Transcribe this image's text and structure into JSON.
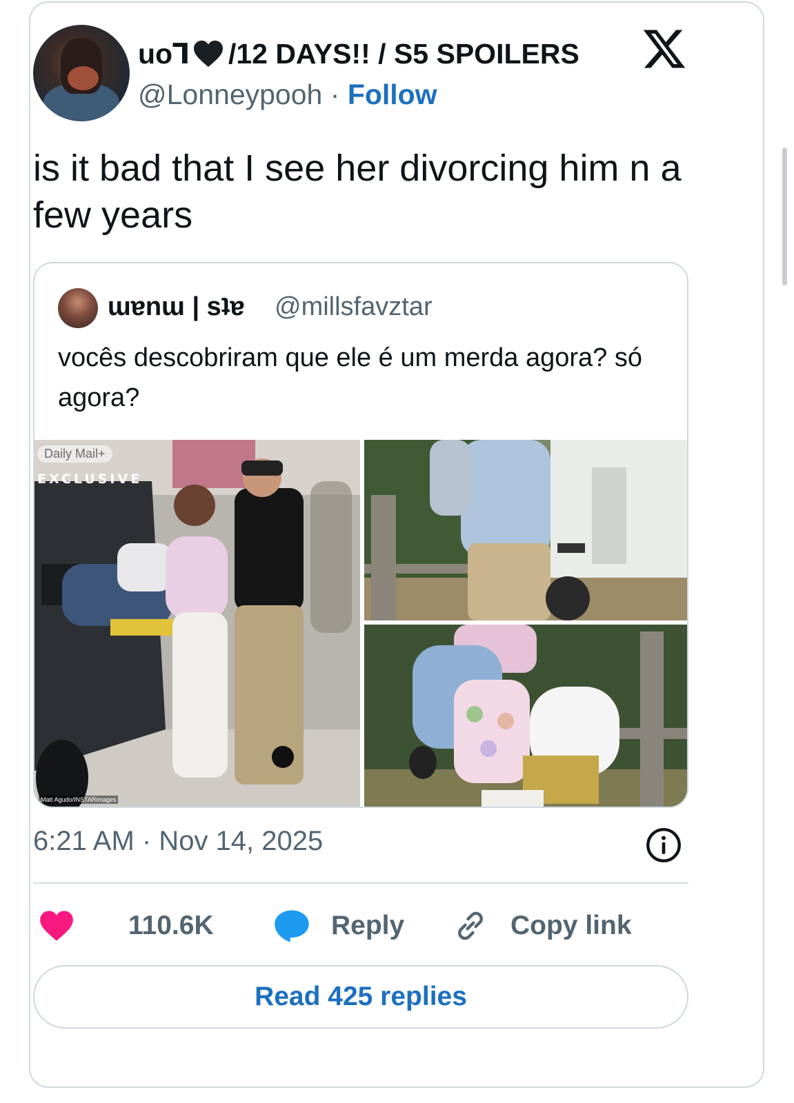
{
  "tweet": {
    "author": {
      "display_name_prefix": "uoꓶ",
      "display_name_suffix": "/12 DAYS!! / S5 SPOILERS",
      "handle": "@Lonneypooh",
      "separator": "·",
      "follow_label": "Follow"
    },
    "text": "is it bad that I see her divorcing him n a few years",
    "timestamp": "6:21 AM · Nov 14, 2025"
  },
  "quoted": {
    "display_name": "ɯɐnɯ | sʇɐ",
    "handle": "@millsfavztar",
    "text": "vocês descobriram que ele é um merda agora? só agora?",
    "photo_overlay": {
      "brand": "Daily Mail+",
      "exclusive": "EXCLUSIVE",
      "credit": "Matt Agudo/INSTARimages"
    }
  },
  "actions": {
    "likes": "110.6K",
    "reply_label": "Reply",
    "copy_link_label": "Copy link",
    "read_replies_label": "Read 425 replies"
  },
  "colors": {
    "link_blue": "#1d6fbf",
    "like_pink": "#f91880",
    "reply_blue": "#1d9bf0",
    "muted_gray": "#536471"
  }
}
